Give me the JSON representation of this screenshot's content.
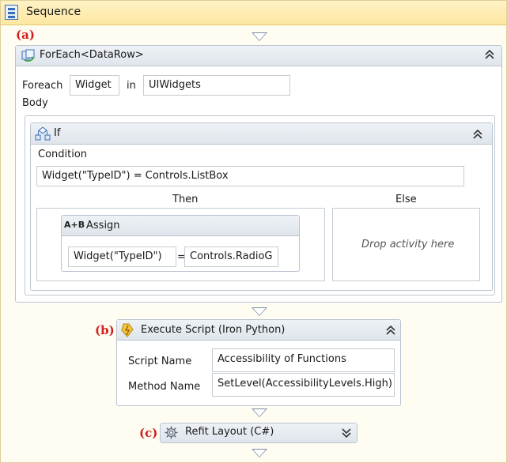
{
  "sequence": {
    "title": "Sequence"
  },
  "callouts": {
    "a": "(a)",
    "b": "(b)",
    "c": "(c)"
  },
  "foreach": {
    "title": "ForEach<DataRow>",
    "foreach_label": "Foreach",
    "item_var": "Widget",
    "in_label": "in",
    "collection": "UIWidgets",
    "body_label": "Body",
    "collapse_glyph": "⌃⌃"
  },
  "if_activity": {
    "title": "If",
    "condition_label": "Condition",
    "condition": "Widget(\"TypeID\") = Controls.ListBox",
    "then_label": "Then",
    "else_label": "Else",
    "else_drop": "Drop activity here"
  },
  "assign": {
    "title": "Assign",
    "icon_text": "A+B",
    "to": "Widget(\"TypeID\")",
    "eq": "=",
    "value": "Controls.RadioG"
  },
  "execute_script": {
    "title": "Execute Script (Iron Python)",
    "script_name_label": "Script Name",
    "script_name": "Accessibility of Functions",
    "method_name_label": "Method Name",
    "method_name": "SetLevel(AccessibilityLevels.High)"
  },
  "refit": {
    "title": "Refit Layout (C#)"
  },
  "colors": {
    "sequence_header": "#fde7a0",
    "callout": "#d21f1f",
    "activity_header": "#e4e9ef"
  }
}
